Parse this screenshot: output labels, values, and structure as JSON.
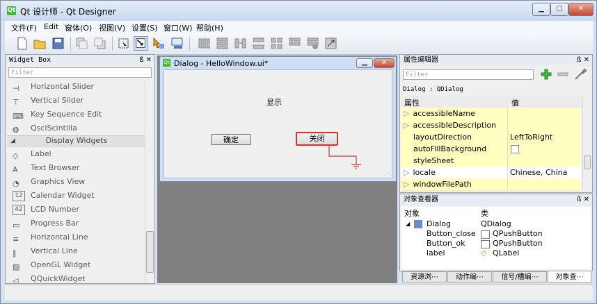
{
  "window": {
    "icon_text": "Qt",
    "title": "Qt 设计师 - Qt Designer",
    "min_glyph": "▁",
    "max_glyph": "▢",
    "close_glyph": "✕"
  },
  "menubar": {
    "items": [
      "文件(F)",
      "Edit",
      "窗体(O)",
      "视图(V)",
      "设置(S)",
      "窗口(W)",
      "帮助(H)"
    ]
  },
  "widget_box": {
    "title": "Widget Box",
    "controls": "ß ✕",
    "filter_placeholder": "Filter",
    "items_top": [
      "Horizontal Slider",
      "Vertical Slider",
      "Key Sequence Edit",
      "QsciScintilla"
    ],
    "category": "Display Widgets",
    "items_display": [
      "Label",
      "Text Browser",
      "Graphics View",
      "Calendar Widget",
      "LCD Number",
      "Progress Bar",
      "Horizontal Line",
      "Vertical Line",
      "OpenGL Widget",
      "QQuickWidget"
    ],
    "icon_glyphs": [
      "⊣",
      "⊤",
      "⌨",
      "❂",
      "◇",
      "A",
      "◔",
      "12",
      "42",
      "▭",
      "≡",
      "‖",
      "▨",
      "◁"
    ]
  },
  "dialog": {
    "icon_text": "Qt",
    "title": "Dialog - HelloWindow.ui*",
    "label_text": "显示",
    "ok_button": "确定",
    "close_button": "关闭"
  },
  "property_editor": {
    "title": "属性编辑器",
    "controls": "ß ✕",
    "filter_placeholder": "Filter",
    "object_line": "Dialog : QDialog",
    "col_property": "属性",
    "col_value": "值",
    "rows": [
      {
        "name": "accessibleName",
        "value": "",
        "expander": "▷"
      },
      {
        "name": "accessibleDescription",
        "value": "",
        "expander": "▷"
      },
      {
        "name": "layoutDirection",
        "value": "LeftToRight",
        "expander": ""
      },
      {
        "name": "autoFillBackground",
        "value": "",
        "expander": ""
      },
      {
        "name": "styleSheet",
        "value": "",
        "expander": ""
      },
      {
        "name": "locale",
        "value": "Chinese, China",
        "expander": "▷"
      },
      {
        "name": "windowFilePath",
        "value": "",
        "expander": "▷"
      }
    ]
  },
  "object_inspector": {
    "title": "对象查看器",
    "controls": "ß ✕",
    "col_object": "对象",
    "col_class": "类",
    "rows": [
      {
        "object": "Dialog",
        "class": "QDialog"
      },
      {
        "object": "Button_close",
        "class": "QPushButton"
      },
      {
        "object": "Button_ok",
        "class": "QPushButton"
      },
      {
        "object": "label",
        "class": "QLabel"
      }
    ]
  },
  "bottom_tabs": [
    "资源浏⋯",
    "动作编⋯",
    "信号/槽编⋯",
    "对象查⋯"
  ],
  "colors": {
    "accent": "#41b83c",
    "highlight": "#ffffc0",
    "close_red": "#d03030"
  }
}
